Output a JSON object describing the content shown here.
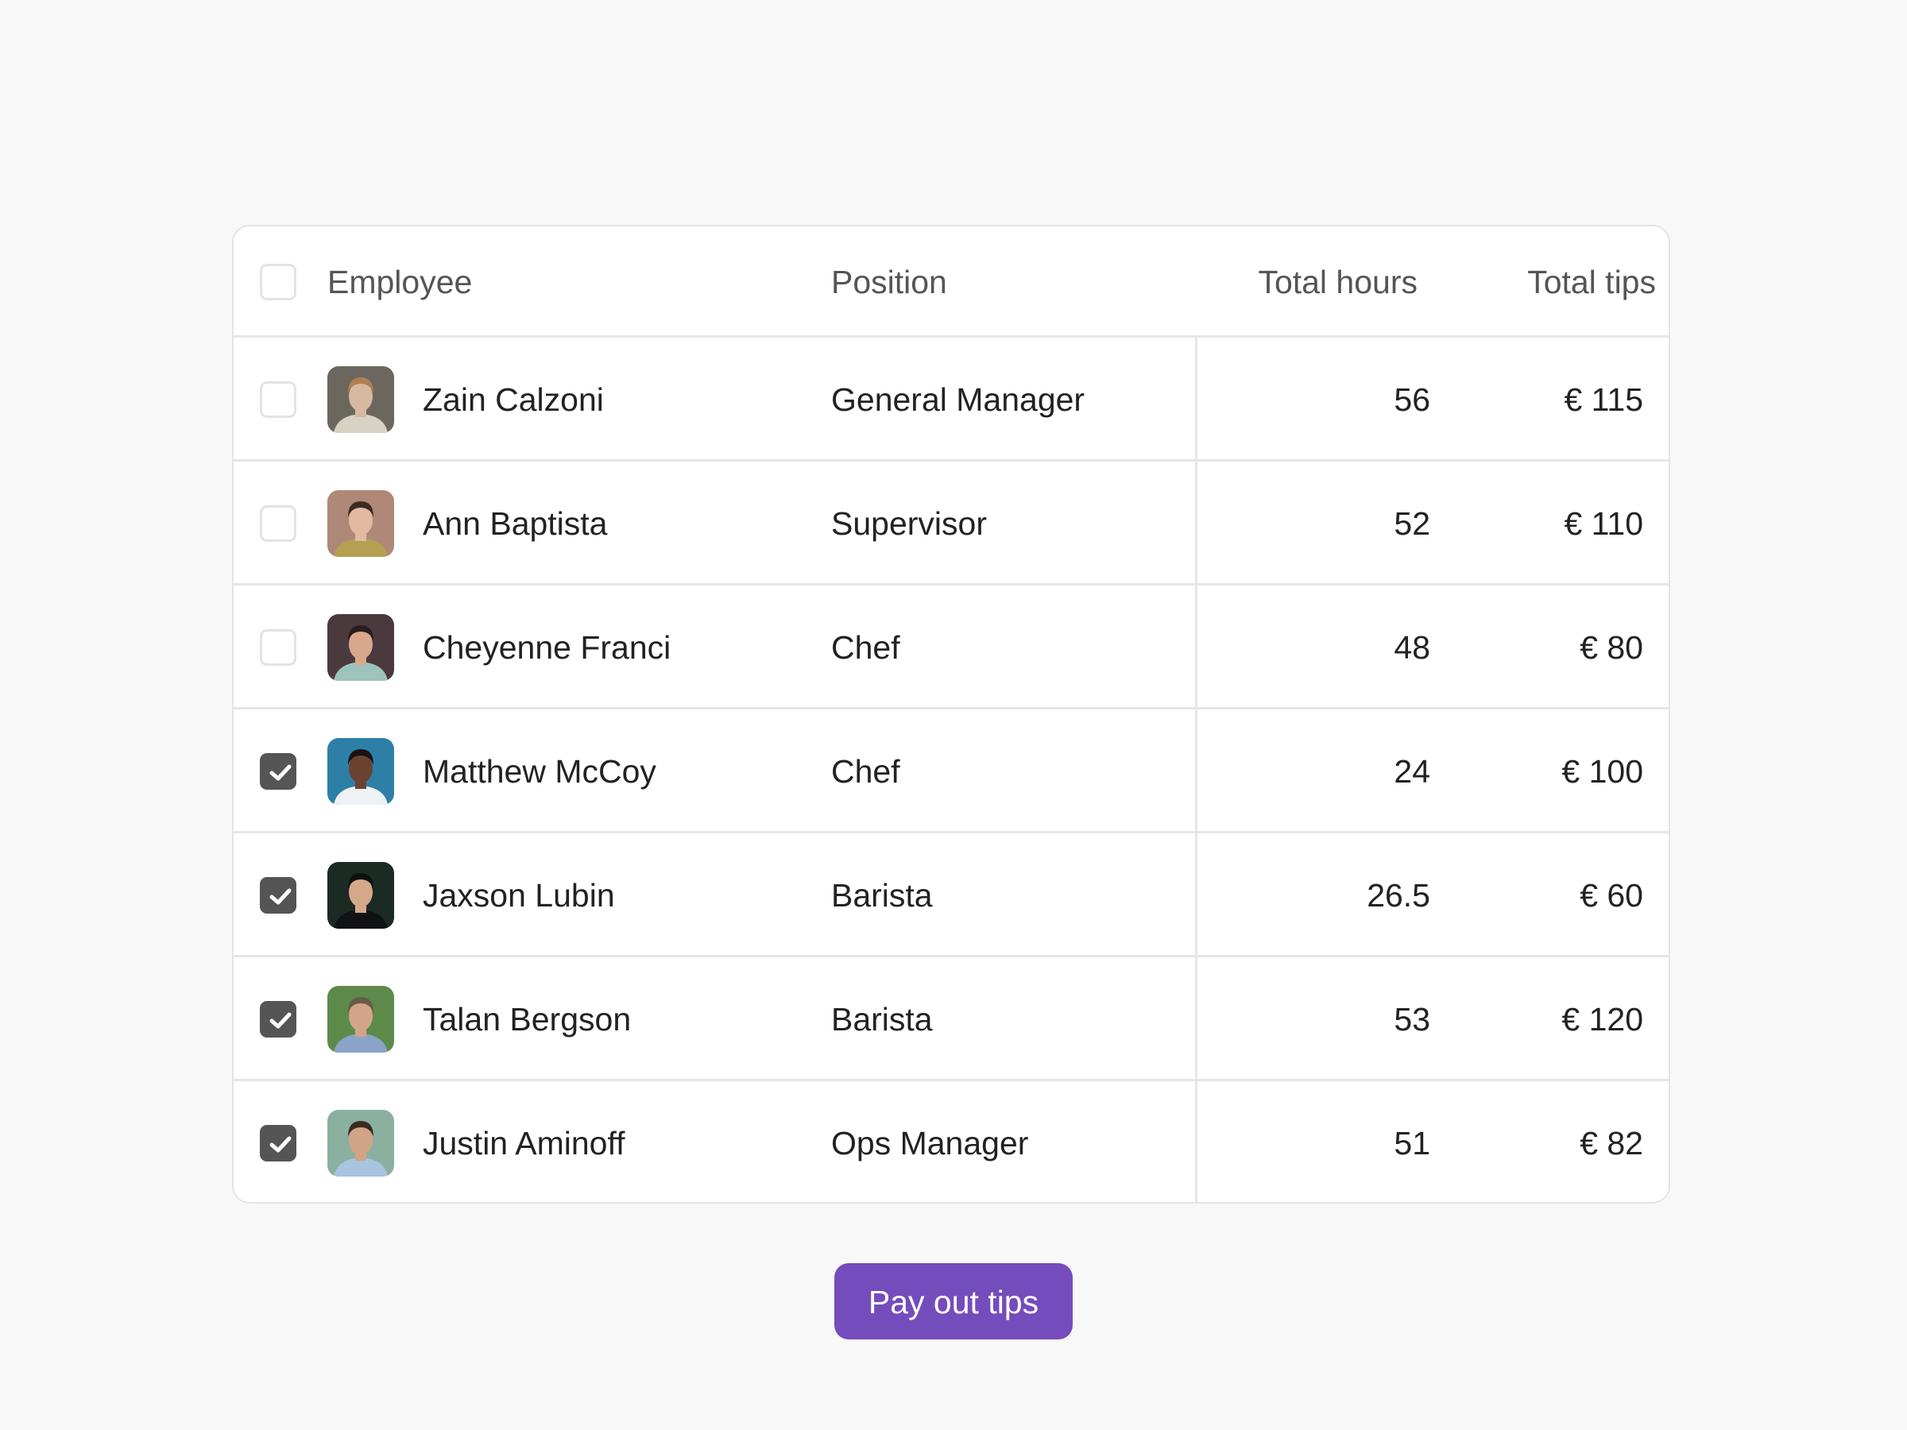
{
  "table": {
    "headers": {
      "employee": "Employee",
      "position": "Position",
      "total_hours": "Total hours",
      "total_tips": "Total tips"
    },
    "select_all_checked": false,
    "rows": [
      {
        "name": "Zain Calzoni",
        "position": "General Manager",
        "hours": "56",
        "tips": "€ 115",
        "checked": false,
        "avatar": {
          "bg": "#6b675e",
          "skin": "#d9b8a0",
          "hair": "#b08050",
          "shirt": "#d8d2c4"
        }
      },
      {
        "name": "Ann Baptista",
        "position": "Supervisor",
        "hours": "52",
        "tips": "€ 110",
        "checked": false,
        "avatar": {
          "bg": "#b08878",
          "skin": "#e2b9a1",
          "hair": "#3c2a22",
          "shirt": "#b4a052"
        }
      },
      {
        "name": "Cheyenne Franci",
        "position": "Chef",
        "hours": "48",
        "tips": "€ 80",
        "checked": false,
        "avatar": {
          "bg": "#4a3a3e",
          "skin": "#d9a88c",
          "hair": "#2a1c1c",
          "shirt": "#9cc4bc"
        }
      },
      {
        "name": "Matthew McCoy",
        "position": "Chef",
        "hours": "24",
        "tips": "€ 100",
        "checked": true,
        "avatar": {
          "bg": "#2e7fa8",
          "skin": "#6a4330",
          "hair": "#1a1210",
          "shirt": "#eef2f4"
        }
      },
      {
        "name": "Jaxson Lubin",
        "position": "Barista",
        "hours": "26.5",
        "tips": "€ 60",
        "checked": true,
        "avatar": {
          "bg": "#1c2a24",
          "skin": "#d6a88a",
          "hair": "#0f0f10",
          "shirt": "#101214"
        }
      },
      {
        "name": "Talan Bergson",
        "position": "Barista",
        "hours": "53",
        "tips": "€ 120",
        "checked": true,
        "avatar": {
          "bg": "#5d8a4a",
          "skin": "#d4a48a",
          "hair": "#6a5a48",
          "shirt": "#8aa4c8"
        }
      },
      {
        "name": "Justin Aminoff",
        "position": "Ops Manager",
        "hours": "51",
        "tips": "€ 82",
        "checked": true,
        "avatar": {
          "bg": "#8cb0a0",
          "skin": "#d2a486",
          "hair": "#3a2a20",
          "shirt": "#a8c4e0"
        }
      }
    ]
  },
  "actions": {
    "pay_out_label": "Pay out tips",
    "accent_color": "#744cbc"
  }
}
